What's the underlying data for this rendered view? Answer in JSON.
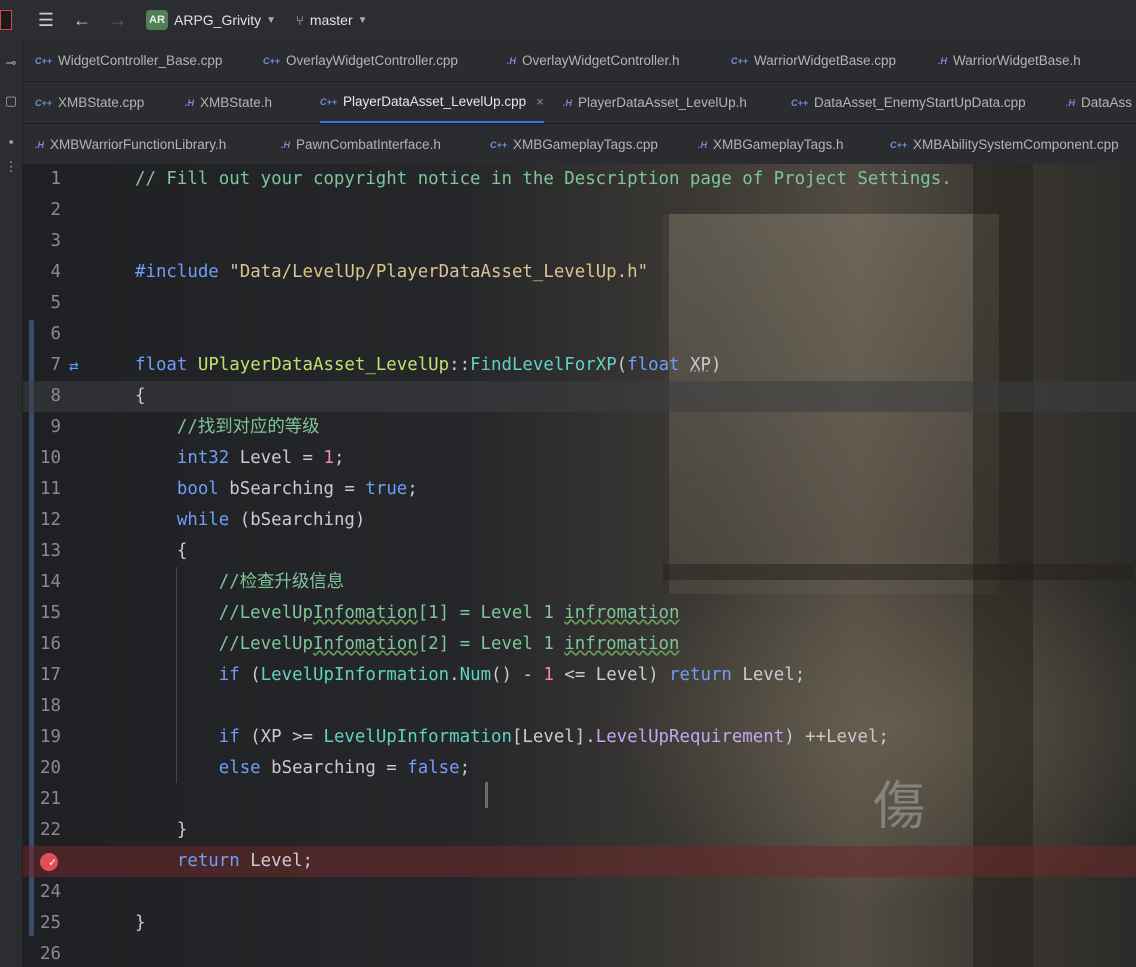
{
  "titlebar": {
    "project_badge": "AR",
    "project_name": "ARPG_Grivity",
    "branch": "master"
  },
  "tabs": {
    "row1": [
      {
        "type": "cpp",
        "label": "WidgetController_Base.cpp"
      },
      {
        "type": "cpp",
        "label": "OverlayWidgetController.cpp"
      },
      {
        "type": "h",
        "label": "OverlayWidgetController.h"
      },
      {
        "type": "cpp",
        "label": "WarriorWidgetBase.cpp"
      },
      {
        "type": "h",
        "label": "WarriorWidgetBase.h"
      }
    ],
    "row2": [
      {
        "type": "cpp",
        "label": "XMBState.cpp"
      },
      {
        "type": "h",
        "label": "XMBState.h"
      },
      {
        "type": "cpp",
        "label": "PlayerDataAsset_LevelUp.cpp",
        "active": true
      },
      {
        "type": "h",
        "label": "PlayerDataAsset_LevelUp.h"
      },
      {
        "type": "cpp",
        "label": "DataAsset_EnemyStartUpData.cpp"
      },
      {
        "type": "h",
        "label": "DataAss"
      }
    ],
    "row3": [
      {
        "type": "h",
        "label": "XMBWarriorFunctionLibrary.h"
      },
      {
        "type": "h",
        "label": "PawnCombatInterface.h"
      },
      {
        "type": "cpp",
        "label": "XMBGameplayTags.cpp"
      },
      {
        "type": "h",
        "label": "XMBGameplayTags.h"
      },
      {
        "type": "cpp",
        "label": "XMBAbilitySystemComponent.cpp"
      }
    ]
  },
  "editor": {
    "line_numbers": [
      "1",
      "2",
      "3",
      "4",
      "5",
      "6",
      "7",
      "8",
      "9",
      "10",
      "11",
      "12",
      "13",
      "14",
      "15",
      "16",
      "17",
      "18",
      "19",
      "20",
      "21",
      "22",
      "",
      "24",
      "25",
      "26"
    ],
    "code": {
      "l1": "// Fill out your copyright notice in the Description page of Project Settings.",
      "l4_kw": "#include",
      "l4_str": "\"Data/LevelUp/PlayerDataAsset_LevelUp.h\"",
      "l7_float": "float",
      "l7_class": "UPlayerDataAsset_LevelUp",
      "l7_sep": "::",
      "l7_fn": "FindLevelForXP",
      "l7_open": "(",
      "l7_ptype": "float",
      "l7_param": "XP",
      "l7_close": ")",
      "l8": "{",
      "l9": "//找到对应的等级",
      "l10_type": "int32",
      "l10_rest": " Level = ",
      "l10_num": "1",
      "l10_end": ";",
      "l11_type": "bool",
      "l11_rest": " bSearching = ",
      "l11_val": "true",
      "l11_end": ";",
      "l12_kw": "while",
      "l12_rest": " (bSearching)",
      "l13": "{",
      "l14": "//检查升级信息",
      "l15_a": "//LevelUp",
      "l15_b": "Infomation",
      "l15_c": "[1] = Level 1 ",
      "l15_d": "infromation",
      "l16_a": "//LevelUp",
      "l16_b": "Infomation",
      "l16_c": "[2] = Level 1 ",
      "l16_d": "infromation",
      "l17_kw": "if",
      "l17_a": " (",
      "l17_mem": "LevelUpInformation",
      "l17_dot": ".",
      "l17_fn": "Num",
      "l17_b": "() - ",
      "l17_num": "1",
      "l17_c": " <= Level) ",
      "l17_ret": "return",
      "l17_d": " Level;",
      "l19_kw": "if",
      "l19_a": " (XP >= ",
      "l19_mem": "LevelUpInformation",
      "l19_b": "[Level].",
      "l19_prop": "LevelUpRequirement",
      "l19_c": ") ++Level;",
      "l20_kw": "else",
      "l20_a": " bSearching = ",
      "l20_val": "false",
      "l20_end": ";",
      "l22": "}",
      "l23_kw": "return",
      "l23_rest": " Level;",
      "l25": "}"
    },
    "wallpaper_glyph": "傷"
  }
}
